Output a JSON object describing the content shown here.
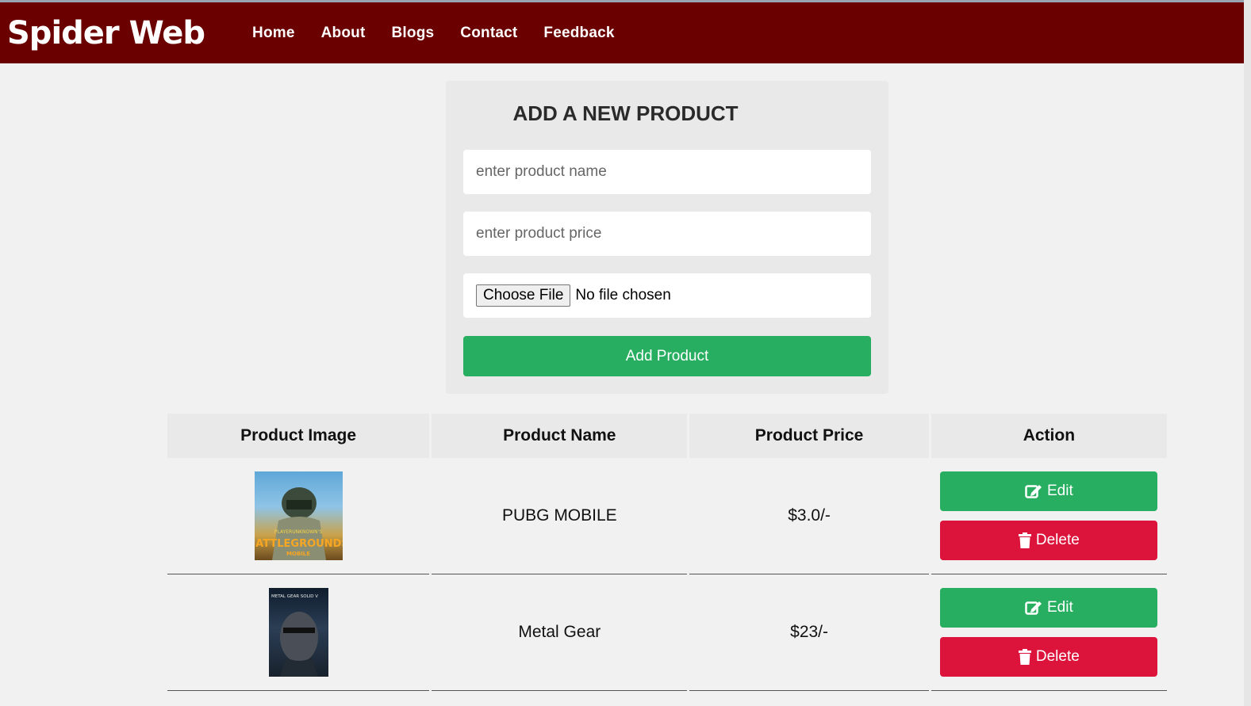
{
  "brand": "Spider Web",
  "nav": [
    "Home",
    "About",
    "Blogs",
    "Contact",
    "Feedback"
  ],
  "form": {
    "title": "ADD A NEW PRODUCT",
    "name_placeholder": "enter product name",
    "price_placeholder": "enter product price",
    "file_button": "Choose File",
    "file_status": "No file chosen",
    "submit": "Add Product"
  },
  "table": {
    "headers": [
      "Product Image",
      "Product Name",
      "Product Price",
      "Action"
    ],
    "rows": [
      {
        "image": "pubg-cover-image",
        "name": "PUBG MOBILE",
        "price": "$3.0/-",
        "edit": "Edit",
        "delete": "Delete"
      },
      {
        "image": "metal-gear-cover-image",
        "name": "Metal Gear",
        "price": "$23/-",
        "edit": "Edit",
        "delete": "Delete"
      }
    ]
  },
  "icons": {
    "edit": "edit-icon",
    "delete": "trash-icon"
  },
  "colors": {
    "navbar": "#6a0000",
    "success": "#27ae60",
    "danger": "#dc143c"
  },
  "pubg_logo_text": [
    "PLAYERUNKNOWN'S",
    "BATTLEGROUNDS",
    "MOBILE"
  ],
  "mgs_logo_text": "METAL GEAR SOLID V"
}
